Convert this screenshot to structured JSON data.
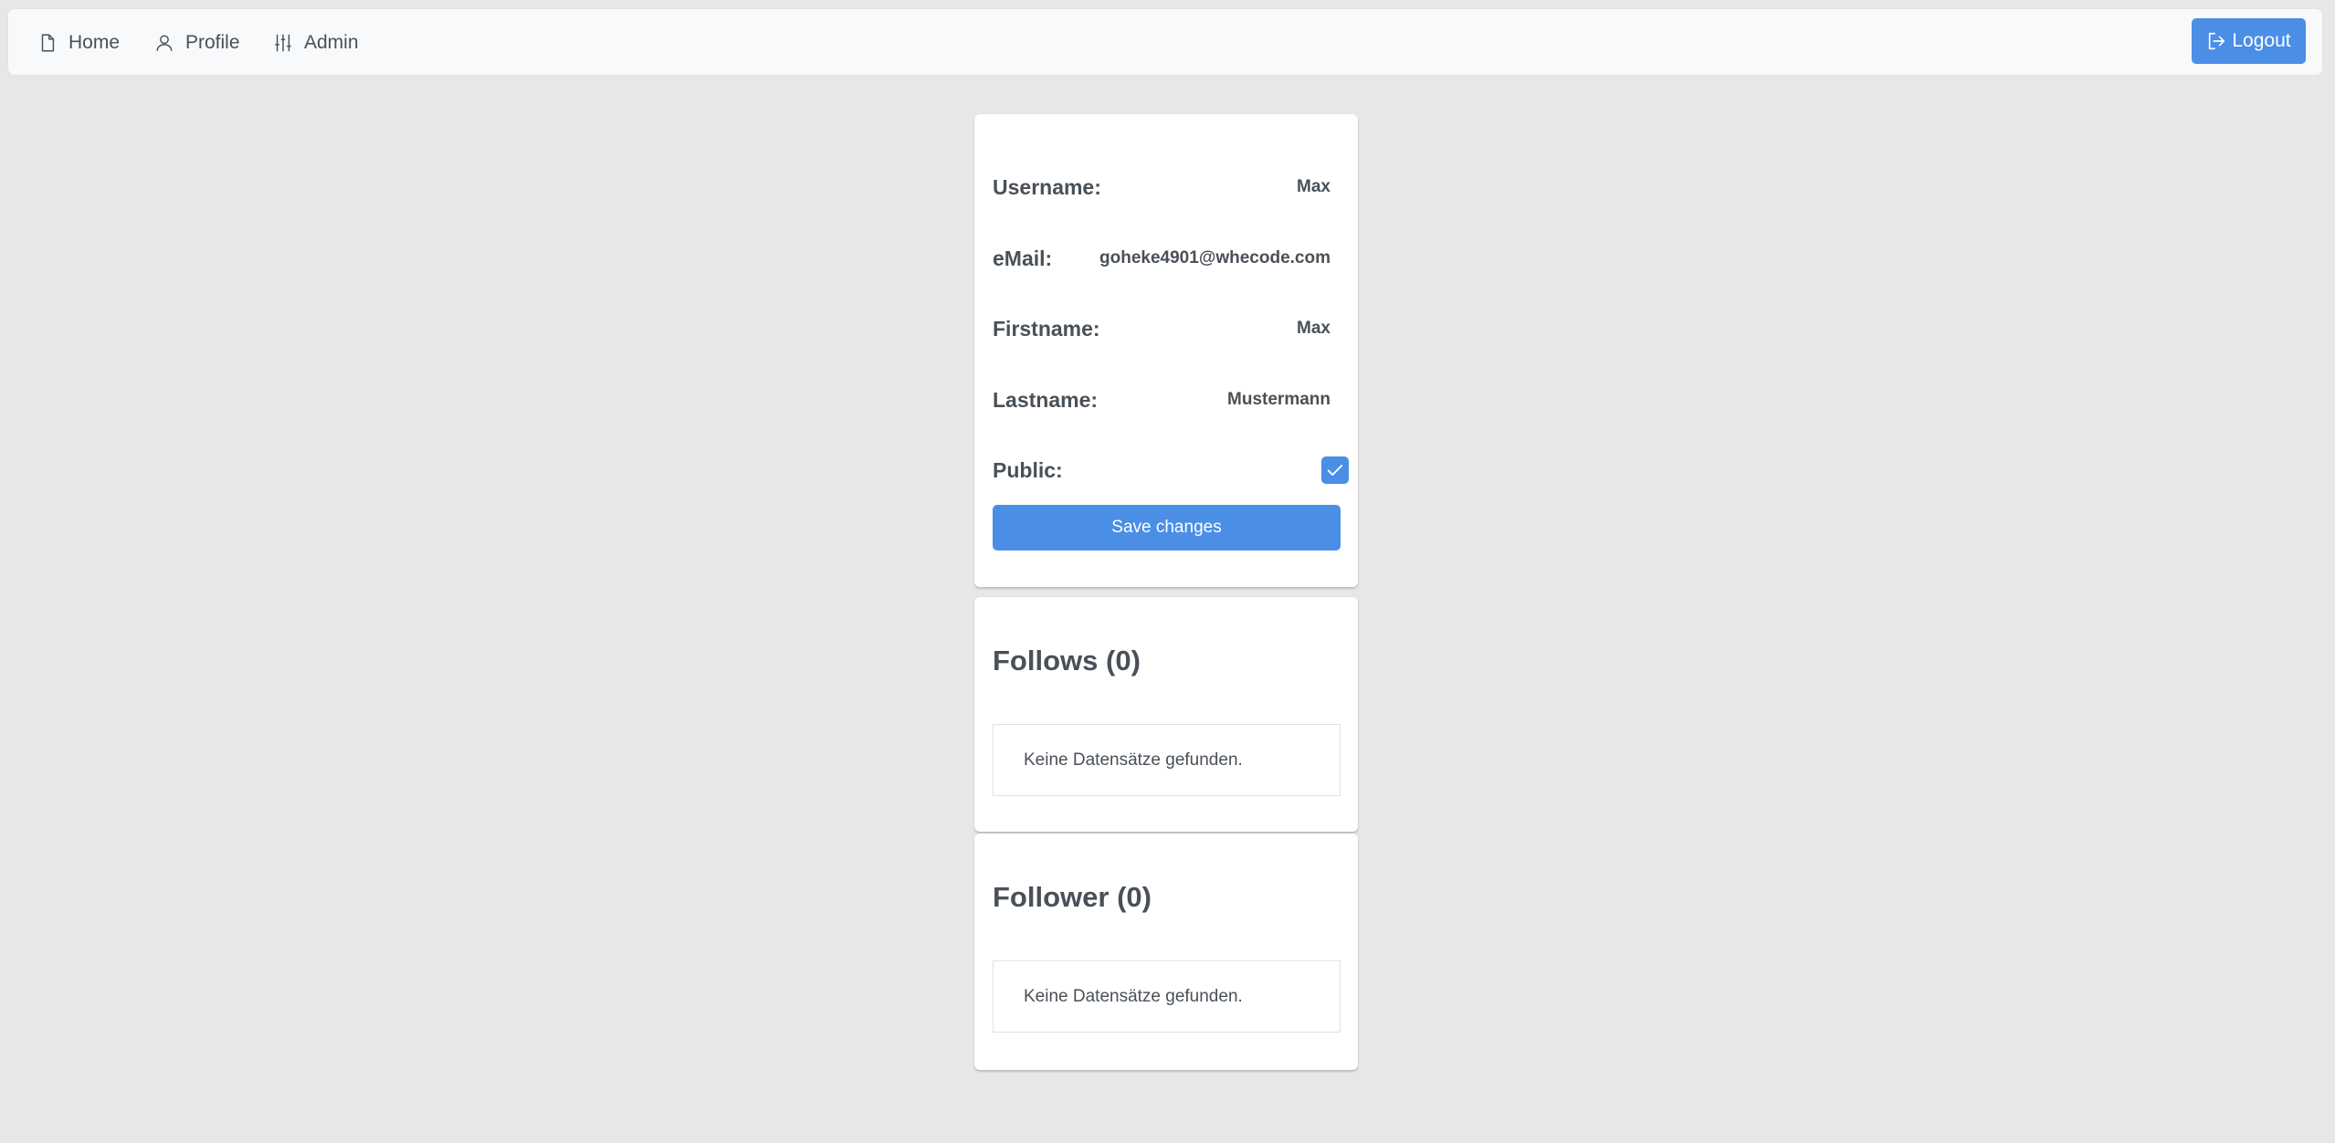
{
  "nav": {
    "items": [
      {
        "label": "Home",
        "icon": "file-icon"
      },
      {
        "label": "Profile",
        "icon": "user-icon"
      },
      {
        "label": "Admin",
        "icon": "sliders-icon"
      }
    ],
    "logout_label": "Logout",
    "logout_icon": "sign-out-icon"
  },
  "profile": {
    "username_label": "Username:",
    "username_value": "Max",
    "email_label": "eMail:",
    "email_value": "goheke4901@whecode.com",
    "firstname_label": "Firstname:",
    "firstname_value": "Max",
    "lastname_label": "Lastname:",
    "lastname_value": "Mustermann",
    "public_label": "Public:",
    "public_checked": true,
    "save_label": "Save changes"
  },
  "follows": {
    "title": "Follows (0)",
    "empty_message": "Keine Datensätze gefunden."
  },
  "follower": {
    "title": "Follower (0)",
    "empty_message": "Keine Datensätze gefunden."
  },
  "colors": {
    "primary": "#4a8ee6",
    "background": "#e7e7e7",
    "text": "#495057"
  }
}
